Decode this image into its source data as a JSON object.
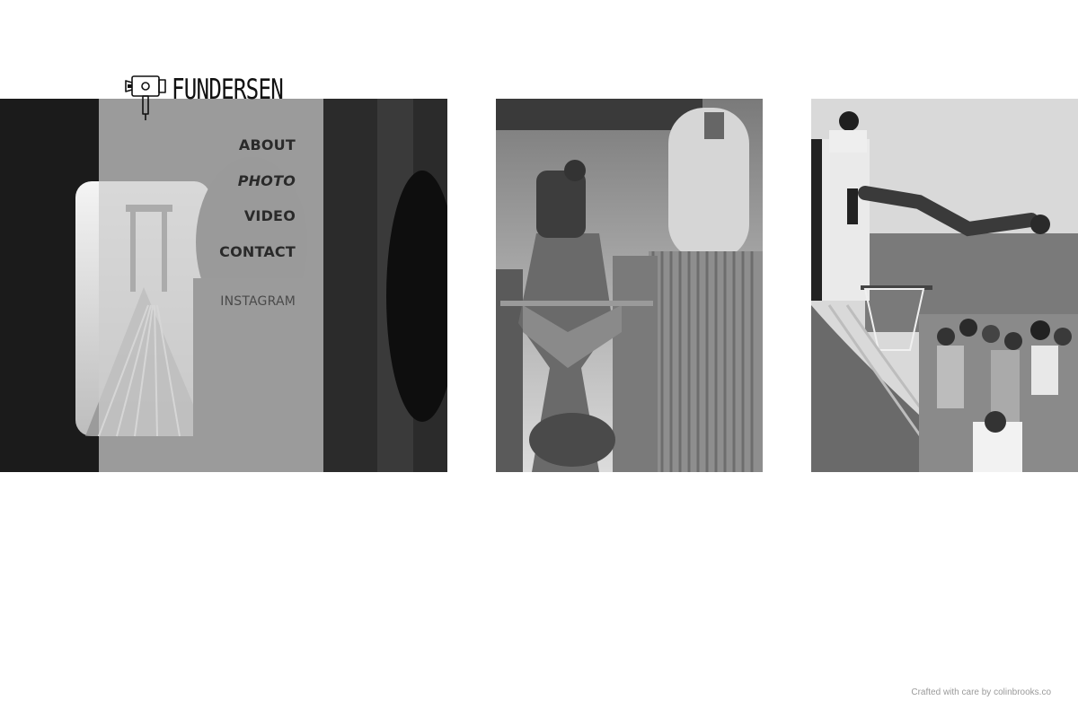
{
  "brand": {
    "name": "FUNDERSEN",
    "logo_icon": "camera-icon"
  },
  "nav": {
    "items": [
      {
        "label": "ABOUT",
        "active": false
      },
      {
        "label": "PHOTO",
        "active": true
      },
      {
        "label": "VIDEO",
        "active": false
      },
      {
        "label": "CONTACT",
        "active": false
      }
    ],
    "social": "INSTAGRAM"
  },
  "gallery": {
    "photos": [
      {
        "subject": "train-window-bridge"
      },
      {
        "subject": "cement-mixer-worker"
      },
      {
        "subject": "skateboarder-halfpipe"
      }
    ]
  },
  "footer": {
    "credit": "Crafted with care by colinbrooks.co"
  },
  "colors": {
    "background": "#ffffff",
    "nav_text": "#2a2a2a",
    "footer_text": "#9a9a9a"
  }
}
